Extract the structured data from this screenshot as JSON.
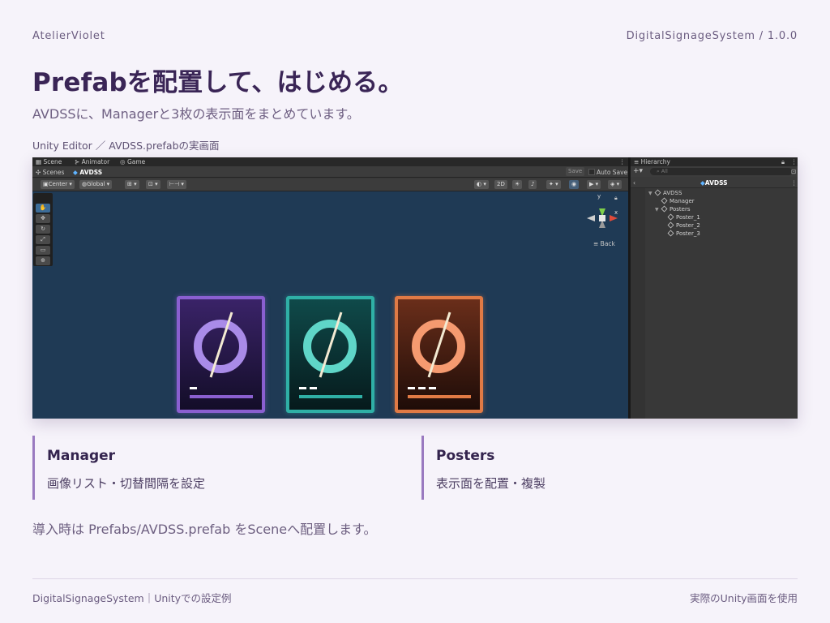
{
  "header": {
    "brand": "AtelierViolet",
    "version": "DigitalSignageSystem / 1.0.0",
    "title": "Prefabを配置して、はじめる。",
    "subtitle": "AVDSSに、Managerと3枚の表示面をまとめています。",
    "caption": "Unity Editor ／ AVDSS.prefabの実画面"
  },
  "editor": {
    "tabs": [
      "Scene",
      "Animator",
      "Game"
    ],
    "scenes_label": "Scenes",
    "prefab_name": "AVDSS",
    "save_label": "Save",
    "auto_save_label": "Auto Save",
    "toolbar": {
      "pivot": "Center",
      "space": "Global",
      "mode_2d": "2D"
    },
    "gizmo": {
      "y_label": "y",
      "x_label": "x",
      "back_label": "Back"
    },
    "hierarchy": {
      "tab": "Hierarchy",
      "search_placeholder": "All",
      "root": "AVDSS",
      "items": [
        {
          "label": "AVDSS",
          "depth": 0
        },
        {
          "label": "Manager",
          "depth": 1
        },
        {
          "label": "Posters",
          "depth": 1
        },
        {
          "label": "Poster_1",
          "depth": 2
        },
        {
          "label": "Poster_2",
          "depth": 2
        },
        {
          "label": "Poster_3",
          "depth": 2
        }
      ]
    },
    "posters": [
      {
        "name": "poster-1",
        "border": "#8a5fd0",
        "bg_top": "#3a2368",
        "bg_bottom": "#130d28",
        "ring": "#a98be8",
        "bar": "#8a5fd0",
        "dashes": 1
      },
      {
        "name": "poster-2",
        "border": "#2fb0a6",
        "bg_top": "#0f4a4a",
        "bg_bottom": "#061a1c",
        "ring": "#5fd6c8",
        "bar": "#2fb0a6",
        "dashes": 2
      },
      {
        "name": "poster-3",
        "border": "#e07a45",
        "bg_top": "#6a2e1a",
        "bg_bottom": "#1e0c08",
        "ring": "#f59a70",
        "bar": "#e07a45",
        "dashes": 3
      }
    ]
  },
  "cards": [
    {
      "title": "Manager",
      "desc": "画像リスト・切替間隔を設定"
    },
    {
      "title": "Posters",
      "desc": "表示面を配置・複製"
    }
  ],
  "note": "導入時は Prefabs/AVDSS.prefab をSceneへ配置します。",
  "footer": {
    "left": "DigitalSignageSystem｜Unityでの設定例",
    "right": "実際のUnity画面を使用"
  }
}
